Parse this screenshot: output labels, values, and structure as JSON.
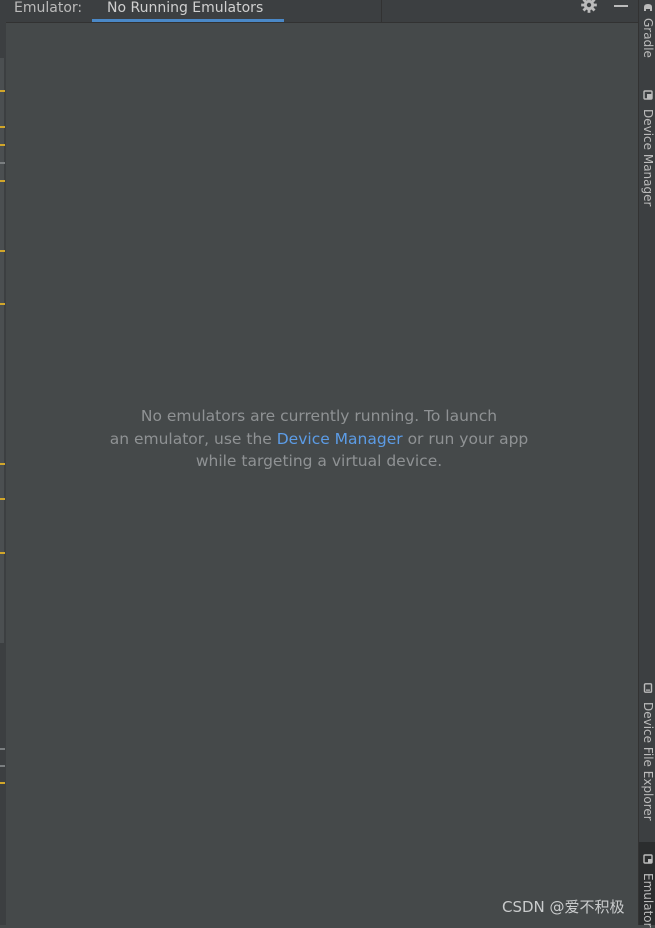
{
  "header": {
    "title": "Emulator:",
    "tab_label": "No Running Emulators"
  },
  "message": {
    "line1": "No emulators are currently running. To launch",
    "line2_prefix": "an emulator, use the ",
    "link": "Device Manager",
    "line2_suffix": " or run your app",
    "line3": "while targeting a virtual device."
  },
  "right_stripe": {
    "gradle": "Gradle",
    "device_manager": "Device Manager",
    "device_file_explorer": "Device File Explorer",
    "emulator": "Emulator"
  },
  "watermark": "CSDN @爱不积极",
  "icons": {
    "settings": "gear-icon",
    "minimize": "minimize-icon",
    "gradle": "elephant-icon",
    "device_manager": "device-manager-icon",
    "device_file_explorer": "device-file-icon",
    "emulator": "emulator-icon"
  },
  "colors": {
    "background": "#45494a",
    "panel": "#3c3f41",
    "link": "#5c9ce6",
    "tab_underline": "#4a88c7",
    "gutter_marker": "#d1a62a"
  }
}
